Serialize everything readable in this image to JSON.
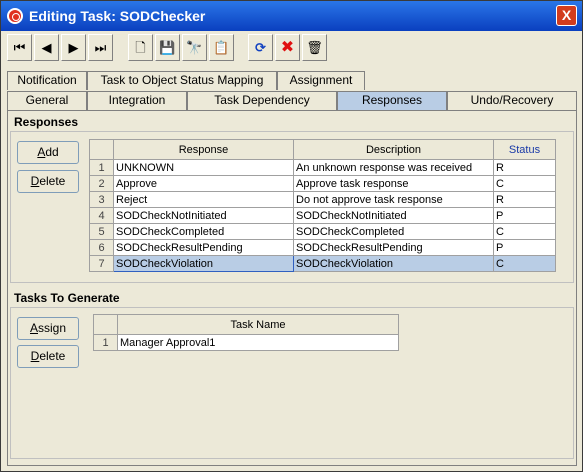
{
  "window": {
    "title": "Editing Task: SODChecker",
    "close_label": "X"
  },
  "toolbar": {
    "buttons": [
      {
        "icon": "first-record-icon",
        "glyph": "⏮"
      },
      {
        "icon": "previous-record-icon",
        "glyph": "◀"
      },
      {
        "icon": "next-record-icon",
        "glyph": "▶"
      },
      {
        "icon": "last-record-icon",
        "glyph": "⏭"
      },
      {
        "icon": "new-document-icon",
        "glyph": "🗋"
      },
      {
        "icon": "save-icon",
        "glyph": "💾"
      },
      {
        "icon": "find-icon",
        "glyph": "🔭"
      },
      {
        "icon": "copy-icon",
        "glyph": "📋"
      },
      {
        "icon": "refresh-icon",
        "glyph": "⟳"
      },
      {
        "icon": "delete-x-icon",
        "glyph": "✖"
      },
      {
        "icon": "trash-icon",
        "glyph": "🗑"
      }
    ]
  },
  "tabs_top": [
    "Notification",
    "Task to Object Status Mapping",
    "Assignment"
  ],
  "tabs_bottom": [
    "General",
    "Integration",
    "Task Dependency",
    "Responses",
    "Undo/Recovery"
  ],
  "active_tab": "Responses",
  "responses": {
    "title": "Responses",
    "add_label": "dd",
    "add_mn": "A",
    "delete_label": "elete",
    "delete_mn": "D",
    "columns": [
      "Response",
      "Description",
      "Status"
    ],
    "rows": [
      {
        "n": "1",
        "response": "UNKNOWN",
        "description": "An unknown response was received",
        "status": "R"
      },
      {
        "n": "2",
        "response": "Approve",
        "description": "Approve task response",
        "status": "C"
      },
      {
        "n": "3",
        "response": "Reject",
        "description": "Do not approve task response",
        "status": "R"
      },
      {
        "n": "4",
        "response": "SODCheckNotInitiated",
        "description": "SODCheckNotInitiated",
        "status": "P"
      },
      {
        "n": "5",
        "response": "SODCheckCompleted",
        "description": "SODCheckCompleted",
        "status": "C"
      },
      {
        "n": "6",
        "response": "SODCheckResultPending",
        "description": "SODCheckResultPending",
        "status": "P"
      },
      {
        "n": "7",
        "response": "SODCheckViolation",
        "description": "SODCheckViolation",
        "status": "C"
      }
    ],
    "selected_row": 7
  },
  "tasks": {
    "title": "Tasks To Generate",
    "assign_label": "ssign",
    "assign_mn": "A",
    "delete_label": "elete",
    "delete_mn": "D",
    "columns": [
      "Task Name"
    ],
    "rows": [
      {
        "n": "1",
        "name": "Manager Approval1"
      }
    ]
  }
}
